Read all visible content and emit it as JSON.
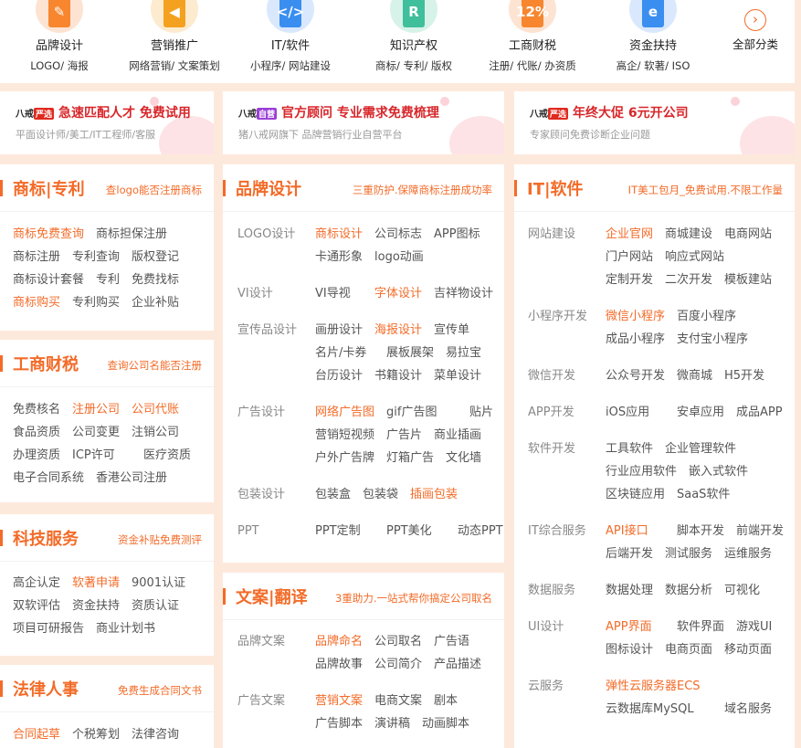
{
  "categories": [
    {
      "title": "品牌设计",
      "subtitle": "LOGO/ 海报",
      "icon": "brand-design-icon",
      "color": "#f7862e",
      "glyph": "✎",
      "bubble": "#fde3d2"
    },
    {
      "title": "营销推广",
      "subtitle": "网络营销/ 文案策划",
      "icon": "megaphone-icon",
      "color": "#f4a11f",
      "glyph": "◀",
      "bubble": "#fdebcf"
    },
    {
      "title": "IT/软件",
      "subtitle": "小程序/ 网站建设",
      "icon": "code-monitor-icon",
      "color": "#3a8ef0",
      "glyph": "</>",
      "bubble": "#d9e8fd"
    },
    {
      "title": "知识产权",
      "subtitle": "商标/ 专利/ 版权",
      "icon": "registered-icon",
      "color": "#3fbf9c",
      "glyph": "R",
      "bubble": "#d7f2e9"
    },
    {
      "title": "工商财税",
      "subtitle": "注册/ 代账/ 办资质",
      "icon": "calculator-icon",
      "color": "#f7862e",
      "glyph": "12%",
      "bubble": "#fde3d2"
    },
    {
      "title": "资金扶持",
      "subtitle": "高企/ 软著/ ISO",
      "icon": "ie-badge-icon",
      "color": "#3a8ef0",
      "glyph": "e",
      "bubble": "#d9e8fd"
    }
  ],
  "all_categories": {
    "label": "全部分类",
    "arrow": "›"
  },
  "banners": [
    {
      "logo_a": "八戒",
      "logo_b": "严选",
      "headline": "急速匹配人才 免费试用",
      "sub": "平面设计师/美工/IT工程师/客服"
    },
    {
      "logo_a": "八戒",
      "logo_b": "自营",
      "headline": "官方顾问 专业需求免费梳理",
      "sub": "猪八戒网旗下 品牌营销行业自营平台"
    },
    {
      "logo_a": "八戒",
      "logo_b": "严选",
      "headline": "年终大促 6元开公司",
      "sub": "专家顾问免费诊断企业问题"
    }
  ],
  "panels": {
    "trademark": {
      "title": "商标|专利",
      "tag": "查logo能否注册商标",
      "rows": [
        [
          "商标免费查询",
          "商标担保注册"
        ],
        [
          "商标注册",
          "专利查询",
          "版权登记"
        ],
        [
          "商标设计套餐",
          "专利",
          "免费找标"
        ],
        [
          "商标购买",
          "专利购买",
          "企业补贴"
        ]
      ]
    },
    "business": {
      "title": "工商财税",
      "tag": "查询公司名能否注册",
      "rows": [
        [
          "免费核名",
          "注册公司",
          "公司代账"
        ],
        [
          "食品资质",
          "公司变更",
          "注销公司"
        ],
        [
          "办理资质",
          "ICP许可",
          "医疗资质"
        ],
        [
          "电子合同系统",
          "香港公司注册"
        ]
      ]
    },
    "tech": {
      "title": "科技服务",
      "tag": "资金补贴免费测评",
      "rows": [
        [
          "高企认定",
          "软著申请",
          "9001认证"
        ],
        [
          "双软评估",
          "资金扶持",
          "资质认证"
        ],
        [
          "项目可研报告",
          "商业计划书"
        ]
      ]
    },
    "legal": {
      "title": "法律人事",
      "tag": "免费生成合同文书",
      "rows": [
        [
          "合同起草",
          "个税筹划",
          "法律咨询"
        ]
      ]
    },
    "brand": {
      "title": "品牌设计",
      "tag": "三重防护.保障商标注册成功率",
      "groups": [
        {
          "label": "LOGO设计",
          "rows": [
            [
              "商标设计",
              "公司标志",
              "APP图标"
            ],
            [
              "卡通形象",
              "logo动画"
            ]
          ]
        },
        {
          "label": "VI设计",
          "rows": [
            [
              "VI导视",
              "字体设计",
              "吉祥物设计"
            ]
          ]
        },
        {
          "label": "宣传品设计",
          "rows": [
            [
              "画册设计",
              "海报设计",
              "宣传单"
            ],
            [
              "名片/卡券",
              "展板展架",
              "易拉宝"
            ],
            [
              "台历设计",
              "书籍设计",
              "菜单设计"
            ]
          ]
        },
        {
          "label": "广告设计",
          "rows": [
            [
              "网络广告图",
              "gif广告图",
              "贴片"
            ],
            [
              "营销短视频",
              "广告片",
              "商业插画"
            ],
            [
              "户外广告牌",
              "灯箱广告",
              "文化墙"
            ]
          ]
        },
        {
          "label": "包装设计",
          "rows": [
            [
              "包装盒",
              "包装袋",
              "插画包装"
            ]
          ]
        },
        {
          "label": "PPT",
          "rows": [
            [
              "PPT定制",
              "PPT美化",
              "动态PPT"
            ]
          ]
        }
      ]
    },
    "copy": {
      "title": "文案|翻译",
      "tag": "3重助力.一站式帮你搞定公司取名",
      "groups": [
        {
          "label": "品牌文案",
          "rows": [
            [
              "品牌命名",
              "公司取名",
              "广告语"
            ],
            [
              "品牌故事",
              "公司简介",
              "产品描述"
            ]
          ]
        },
        {
          "label": "广告文案",
          "rows": [
            [
              "营销文案",
              "电商文案",
              "剧本"
            ],
            [
              "广告脚本",
              "演讲稿",
              "动画脚本"
            ]
          ]
        }
      ]
    },
    "it": {
      "title": "IT|软件",
      "tag": "IT美工包月_免费试用.不限工作量",
      "groups": [
        {
          "label": "网站建设",
          "rows": [
            [
              "企业官网",
              "商城建设",
              "电商网站"
            ],
            [
              "门户网站",
              "响应式网站"
            ],
            [
              "定制开发",
              "二次开发",
              "模板建站"
            ]
          ]
        },
        {
          "label": "小程序开发",
          "rows": [
            [
              "微信小程序",
              "百度小程序"
            ],
            [
              "成品小程序",
              "支付宝小程序"
            ]
          ]
        },
        {
          "label": "微信开发",
          "rows": [
            [
              "公众号开发",
              "微商城",
              "H5开发"
            ]
          ]
        },
        {
          "label": "APP开发",
          "rows": [
            [
              "iOS应用",
              "安卓应用",
              "成品APP"
            ]
          ]
        },
        {
          "label": "软件开发",
          "rows": [
            [
              "工具软件",
              "企业管理软件"
            ],
            [
              "行业应用软件",
              "嵌入式软件"
            ],
            [
              "区块链应用",
              "SaaS软件"
            ]
          ]
        },
        {
          "label": "IT综合服务",
          "rows": [
            [
              "API接口",
              "脚本开发",
              "前端开发"
            ],
            [
              "后端开发",
              "测试服务",
              "运维服务"
            ]
          ]
        },
        {
          "label": "数据服务",
          "rows": [
            [
              "数据处理",
              "数据分析",
              "可视化"
            ]
          ]
        },
        {
          "label": "UI设计",
          "rows": [
            [
              "APP界面",
              "软件界面",
              "游戏UI"
            ],
            [
              "图标设计",
              "电商页面",
              "移动页面"
            ]
          ]
        },
        {
          "label": "云服务",
          "rows": [
            [
              "弹性云服务器ECS"
            ],
            [
              "云数据库MySQL",
              "域名服务"
            ]
          ]
        }
      ]
    }
  },
  "hot_links": [
    "商标免费查询",
    "商标购买",
    "注册公司",
    "公司代账",
    "软著申请",
    "合同起草",
    "商标设计",
    "字体设计",
    "海报设计",
    "网络广告图",
    "插画包装",
    "品牌命名",
    "营销文案",
    "企业官网",
    "微信小程序",
    "API接口",
    "APP界面",
    "弹性云服务器ECS"
  ],
  "colors": {
    "accent": "#f36b28",
    "headline_red": "#d8262a",
    "page_bg": "#fde9dc"
  }
}
